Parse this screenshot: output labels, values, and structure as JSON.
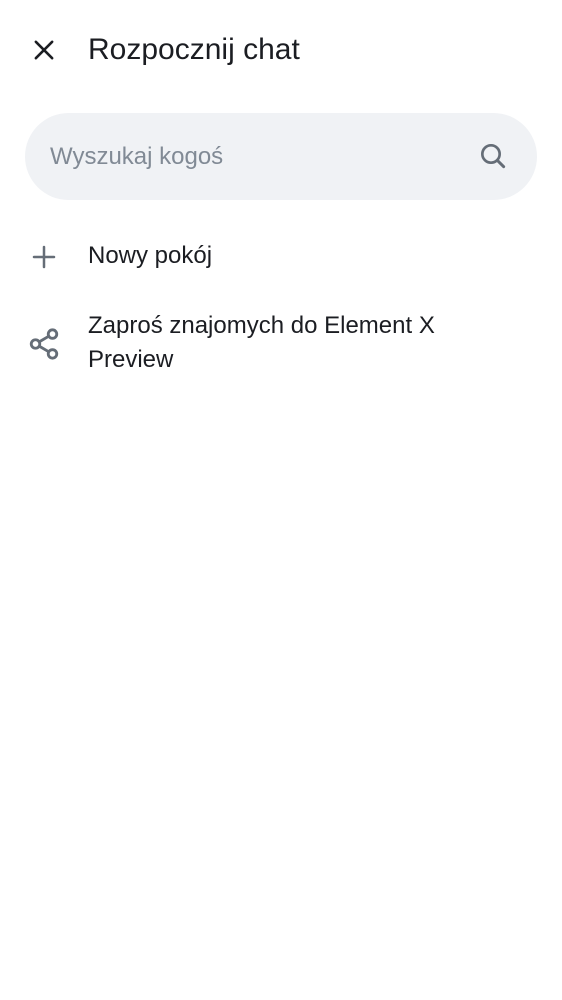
{
  "header": {
    "title": "Rozpocznij chat",
    "close_icon": "close-icon"
  },
  "search": {
    "placeholder": "Wyszukaj kogoś",
    "value": "",
    "icon": "search-icon"
  },
  "actions": [
    {
      "label": "Nowy pokój",
      "icon": "plus-icon"
    },
    {
      "label": "Zaproś znajomych do Element X Preview",
      "icon": "share-icon"
    }
  ],
  "colors": {
    "background": "#ffffff",
    "search_bg": "#f0f2f5",
    "text": "#1b1d22",
    "placeholder": "#818a95",
    "icon": "#656d77"
  }
}
